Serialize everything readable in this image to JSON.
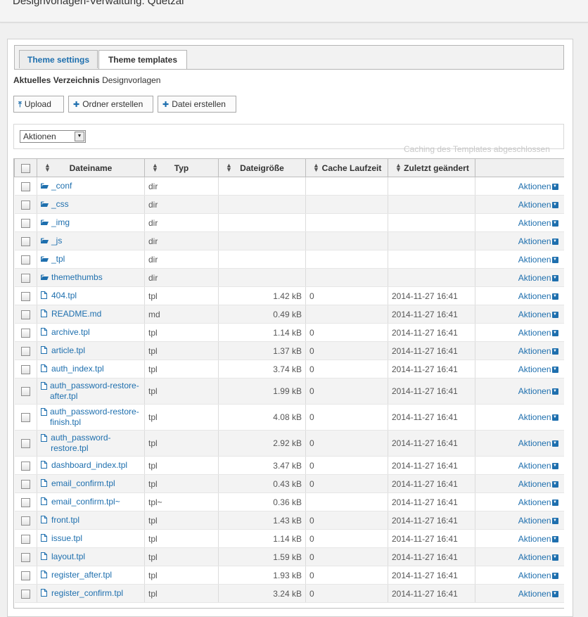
{
  "page": {
    "title": "Designvorlagen-Verwaltung: Quetzal"
  },
  "tabs": [
    {
      "label": "Theme settings"
    },
    {
      "label": "Theme templates"
    }
  ],
  "directory": {
    "label": "Aktuelles Verzeichnis",
    "value": "Designvorlagen"
  },
  "toolbar": {
    "upload_label": "Upload",
    "new_folder_label": "Ordner erstellen",
    "new_file_label": "Datei erstellen"
  },
  "actions_select": {
    "value": "Aktionen"
  },
  "status": {
    "caching": "Caching des Templates abgeschlossen"
  },
  "table": {
    "columns": {
      "name": "Dateiname",
      "type": "Typ",
      "size": "Dateigröße",
      "cache": "Cache Laufzeit",
      "modified": "Zuletzt geändert"
    },
    "action_label": "Aktionen",
    "rows": [
      {
        "name": "_conf",
        "icon": "folder-icon",
        "type": "dir",
        "size": "",
        "cache": "",
        "modified": ""
      },
      {
        "name": "_css",
        "icon": "folder-icon",
        "type": "dir",
        "size": "",
        "cache": "",
        "modified": ""
      },
      {
        "name": "_img",
        "icon": "folder-icon",
        "type": "dir",
        "size": "",
        "cache": "",
        "modified": ""
      },
      {
        "name": "_js",
        "icon": "folder-icon",
        "type": "dir",
        "size": "",
        "cache": "",
        "modified": ""
      },
      {
        "name": "_tpl",
        "icon": "folder-icon",
        "type": "dir",
        "size": "",
        "cache": "",
        "modified": ""
      },
      {
        "name": "themethumbs",
        "icon": "folder-icon",
        "type": "dir",
        "size": "",
        "cache": "",
        "modified": ""
      },
      {
        "name": "404.tpl",
        "icon": "file-icon",
        "type": "tpl",
        "size": "1.42 kB",
        "cache": "0",
        "modified": "2014-11-27 16:41"
      },
      {
        "name": "README.md",
        "icon": "file-icon",
        "type": "md",
        "size": "0.49 kB",
        "cache": "",
        "modified": "2014-11-27 16:41"
      },
      {
        "name": "archive.tpl",
        "icon": "file-icon",
        "type": "tpl",
        "size": "1.14 kB",
        "cache": "0",
        "modified": "2014-11-27 16:41"
      },
      {
        "name": "article.tpl",
        "icon": "file-icon",
        "type": "tpl",
        "size": "1.37 kB",
        "cache": "0",
        "modified": "2014-11-27 16:41"
      },
      {
        "name": "auth_index.tpl",
        "icon": "file-icon",
        "type": "tpl",
        "size": "3.74 kB",
        "cache": "0",
        "modified": "2014-11-27 16:41"
      },
      {
        "name": "auth_password-restore-after.tpl",
        "icon": "file-icon",
        "type": "tpl",
        "size": "1.99 kB",
        "cache": "0",
        "modified": "2014-11-27 16:41"
      },
      {
        "name": "auth_password-restore-finish.tpl",
        "icon": "file-icon",
        "type": "tpl",
        "size": "4.08 kB",
        "cache": "0",
        "modified": "2014-11-27 16:41"
      },
      {
        "name": "auth_password-restore.tpl",
        "icon": "file-icon",
        "type": "tpl",
        "size": "2.92 kB",
        "cache": "0",
        "modified": "2014-11-27 16:41"
      },
      {
        "name": "dashboard_index.tpl",
        "icon": "file-icon",
        "type": "tpl",
        "size": "3.47 kB",
        "cache": "0",
        "modified": "2014-11-27 16:41"
      },
      {
        "name": "email_confirm.tpl",
        "icon": "file-icon",
        "type": "tpl",
        "size": "0.43 kB",
        "cache": "0",
        "modified": "2014-11-27 16:41"
      },
      {
        "name": "email_confirm.tpl~",
        "icon": "file-icon",
        "type": "tpl~",
        "size": "0.36 kB",
        "cache": "",
        "modified": "2014-11-27 16:41"
      },
      {
        "name": "front.tpl",
        "icon": "file-icon",
        "type": "tpl",
        "size": "1.43 kB",
        "cache": "0",
        "modified": "2014-11-27 16:41"
      },
      {
        "name": "issue.tpl",
        "icon": "file-icon",
        "type": "tpl",
        "size": "1.14 kB",
        "cache": "0",
        "modified": "2014-11-27 16:41"
      },
      {
        "name": "layout.tpl",
        "icon": "file-icon",
        "type": "tpl",
        "size": "1.59 kB",
        "cache": "0",
        "modified": "2014-11-27 16:41"
      },
      {
        "name": "register_after.tpl",
        "icon": "file-icon",
        "type": "tpl",
        "size": "1.93 kB",
        "cache": "0",
        "modified": "2014-11-27 16:41"
      },
      {
        "name": "register_confirm.tpl",
        "icon": "file-icon",
        "type": "tpl",
        "size": "3.24 kB",
        "cache": "0",
        "modified": "2014-11-27 16:41"
      }
    ]
  },
  "colors": {
    "link": "#1e6fae",
    "header_bg": "#f0f0f0",
    "row_alt": "#f3f3f3"
  }
}
